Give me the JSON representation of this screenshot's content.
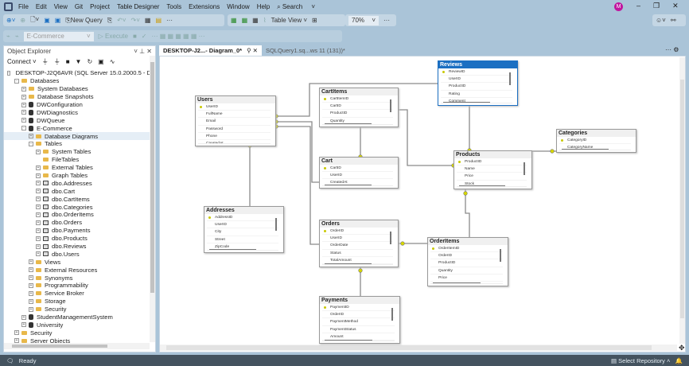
{
  "menu": [
    "File",
    "Edit",
    "View",
    "Git",
    "Project",
    "Table Designer",
    "Tools",
    "Extensions",
    "Window",
    "Help"
  ],
  "search_label": "Search",
  "avatar_initial": "M",
  "toolbar": {
    "new_query": "New Query",
    "table_view": "Table View",
    "zoom": "70%",
    "database": "E-Commerce",
    "execute": "Execute"
  },
  "object_explorer": {
    "title": "Object Explorer",
    "connect": "Connect",
    "nodes": [
      {
        "label": "DESKTOP-J2Q6AVR (SQL Server 15.0.2000.5 - DESKTOP",
        "level": 0,
        "icon": "server",
        "exp": "-"
      },
      {
        "label": "Databases",
        "level": 1,
        "icon": "folder",
        "exp": "-"
      },
      {
        "label": "System Databases",
        "level": 2,
        "icon": "folder",
        "exp": "+"
      },
      {
        "label": "Database Snapshots",
        "level": 2,
        "icon": "folder",
        "exp": "+"
      },
      {
        "label": "DWConfiguration",
        "level": 2,
        "icon": "db",
        "exp": "+"
      },
      {
        "label": "DWDiagnostics",
        "level": 2,
        "icon": "db",
        "exp": "+"
      },
      {
        "label": "DWQueue",
        "level": 2,
        "icon": "db",
        "exp": "+"
      },
      {
        "label": "E-Commerce",
        "level": 2,
        "icon": "db",
        "exp": "-"
      },
      {
        "label": "Database Diagrams",
        "level": 3,
        "icon": "folder",
        "exp": "+"
      },
      {
        "label": "Tables",
        "level": 3,
        "icon": "folder",
        "exp": "-"
      },
      {
        "label": "System Tables",
        "level": 4,
        "icon": "folder",
        "exp": "+"
      },
      {
        "label": "FileTables",
        "level": 4,
        "icon": "folder",
        "exp": ""
      },
      {
        "label": "External Tables",
        "level": 4,
        "icon": "folder",
        "exp": "+"
      },
      {
        "label": "Graph Tables",
        "level": 4,
        "icon": "folder",
        "exp": "+"
      },
      {
        "label": "dbo.Addresses",
        "level": 4,
        "icon": "table",
        "exp": "+"
      },
      {
        "label": "dbo.Cart",
        "level": 4,
        "icon": "table",
        "exp": "+"
      },
      {
        "label": "dbo.CartItems",
        "level": 4,
        "icon": "table",
        "exp": "+"
      },
      {
        "label": "dbo.Categories",
        "level": 4,
        "icon": "table",
        "exp": "+"
      },
      {
        "label": "dbo.OrderItems",
        "level": 4,
        "icon": "table",
        "exp": "+"
      },
      {
        "label": "dbo.Orders",
        "level": 4,
        "icon": "table",
        "exp": "+"
      },
      {
        "label": "dbo.Payments",
        "level": 4,
        "icon": "table",
        "exp": "+"
      },
      {
        "label": "dbo.Products",
        "level": 4,
        "icon": "table",
        "exp": "+"
      },
      {
        "label": "dbo.Reviews",
        "level": 4,
        "icon": "table",
        "exp": "+"
      },
      {
        "label": "dbo.Users",
        "level": 4,
        "icon": "table",
        "exp": "+"
      },
      {
        "label": "Views",
        "level": 3,
        "icon": "folder",
        "exp": "+"
      },
      {
        "label": "External Resources",
        "level": 3,
        "icon": "folder",
        "exp": "+"
      },
      {
        "label": "Synonyms",
        "level": 3,
        "icon": "folder",
        "exp": "+"
      },
      {
        "label": "Programmability",
        "level": 3,
        "icon": "folder",
        "exp": "+"
      },
      {
        "label": "Service Broker",
        "level": 3,
        "icon": "folder",
        "exp": "+"
      },
      {
        "label": "Storage",
        "level": 3,
        "icon": "folder",
        "exp": "+"
      },
      {
        "label": "Security",
        "level": 3,
        "icon": "folder",
        "exp": "+"
      },
      {
        "label": "StudentManagementSystem",
        "level": 2,
        "icon": "db",
        "exp": "+"
      },
      {
        "label": "University",
        "level": 2,
        "icon": "db",
        "exp": "+"
      },
      {
        "label": "Security",
        "level": 1,
        "icon": "folder",
        "exp": "+"
      },
      {
        "label": "Server Objects",
        "level": 1,
        "icon": "folder",
        "exp": "+"
      }
    ]
  },
  "tabs": [
    {
      "label": "DESKTOP-J2...- Diagram_0*",
      "active": true
    },
    {
      "label": "SQLQuery1.sq...ws 11 (131))*",
      "active": false
    }
  ],
  "diagram": {
    "tables": [
      {
        "id": "users",
        "name": "Users",
        "columns": [
          "UserID",
          "FullName",
          "Email",
          "Password",
          "Phone",
          "CreatedAt"
        ]
      },
      {
        "id": "cartitems",
        "name": "CartItems",
        "columns": [
          "CartItemID",
          "CartID",
          "ProductID",
          "Quantity"
        ]
      },
      {
        "id": "reviews",
        "name": "Reviews",
        "selected": true,
        "columns": [
          "ReviewID",
          "UserID",
          "ProductID",
          "Rating",
          "Comment"
        ]
      },
      {
        "id": "categories",
        "name": "Categories",
        "columns": [
          "CategoryID",
          "CategoryName"
        ]
      },
      {
        "id": "products",
        "name": "Products",
        "columns": [
          "ProductID",
          "Name",
          "Price",
          "Stock"
        ]
      },
      {
        "id": "cart",
        "name": "Cart",
        "columns": [
          "CartID",
          "UserID",
          "CreatedAt"
        ]
      },
      {
        "id": "addresses",
        "name": "Addresses",
        "columns": [
          "AddressID",
          "UserID",
          "City",
          "Street",
          "ZipCode"
        ]
      },
      {
        "id": "orders",
        "name": "Orders",
        "columns": [
          "OrderID",
          "UserID",
          "OrderDate",
          "Status",
          "TotalAmount"
        ]
      },
      {
        "id": "orderitems",
        "name": "OrderItems",
        "columns": [
          "OrderItemID",
          "OrderID",
          "ProductID",
          "Quantity",
          "Price"
        ]
      },
      {
        "id": "payments",
        "name": "Payments",
        "columns": [
          "PaymentID",
          "OrderID",
          "PaymentMethod",
          "PaymentStatus",
          "Amount"
        ]
      }
    ]
  },
  "status": {
    "left": "Ready",
    "right": "Select Repository"
  }
}
